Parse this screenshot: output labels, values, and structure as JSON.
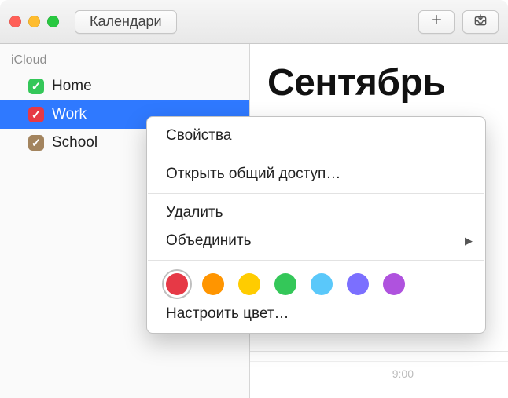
{
  "toolbar": {
    "calendars_label": "Календари"
  },
  "sidebar": {
    "section": "iCloud",
    "items": [
      {
        "name": "Home",
        "color": "#34c759"
      },
      {
        "name": "Work",
        "color": "#e63946"
      },
      {
        "name": "School",
        "color": "#a3845e"
      }
    ],
    "selected_index": 1
  },
  "main": {
    "month": "Сентябрь",
    "time_label": "9:00"
  },
  "context_menu": {
    "items": [
      {
        "label": "Свойства"
      },
      {
        "label": "Открыть общий доступ…"
      },
      {
        "label": "Удалить"
      },
      {
        "label": "Объединить",
        "submenu": true
      }
    ],
    "colors": [
      "#e63946",
      "#ff9500",
      "#ffcc00",
      "#34c759",
      "#5ac8fa",
      "#7b6fff",
      "#af52de"
    ],
    "selected_color_index": 0,
    "custom_color_label": "Настроить цвет…"
  }
}
